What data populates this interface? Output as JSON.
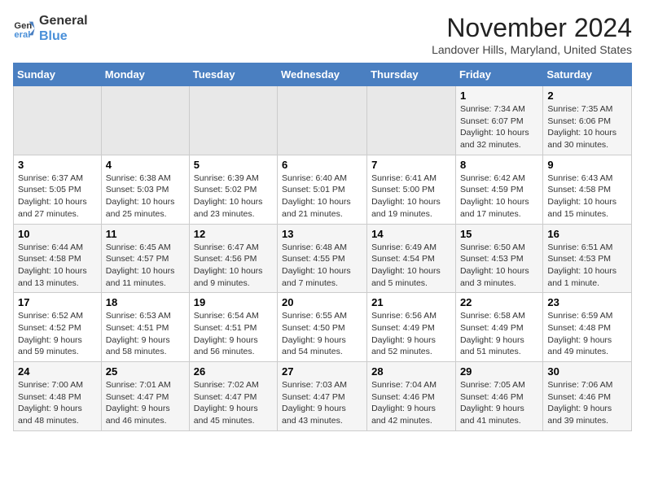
{
  "logo": {
    "line1": "General",
    "line2": "Blue"
  },
  "title": "November 2024",
  "subtitle": "Landover Hills, Maryland, United States",
  "days_of_week": [
    "Sunday",
    "Monday",
    "Tuesday",
    "Wednesday",
    "Thursday",
    "Friday",
    "Saturday"
  ],
  "weeks": [
    [
      {
        "day": "",
        "info": ""
      },
      {
        "day": "",
        "info": ""
      },
      {
        "day": "",
        "info": ""
      },
      {
        "day": "",
        "info": ""
      },
      {
        "day": "",
        "info": ""
      },
      {
        "day": "1",
        "info": "Sunrise: 7:34 AM\nSunset: 6:07 PM\nDaylight: 10 hours and 32 minutes."
      },
      {
        "day": "2",
        "info": "Sunrise: 7:35 AM\nSunset: 6:06 PM\nDaylight: 10 hours and 30 minutes."
      }
    ],
    [
      {
        "day": "3",
        "info": "Sunrise: 6:37 AM\nSunset: 5:05 PM\nDaylight: 10 hours and 27 minutes."
      },
      {
        "day": "4",
        "info": "Sunrise: 6:38 AM\nSunset: 5:03 PM\nDaylight: 10 hours and 25 minutes."
      },
      {
        "day": "5",
        "info": "Sunrise: 6:39 AM\nSunset: 5:02 PM\nDaylight: 10 hours and 23 minutes."
      },
      {
        "day": "6",
        "info": "Sunrise: 6:40 AM\nSunset: 5:01 PM\nDaylight: 10 hours and 21 minutes."
      },
      {
        "day": "7",
        "info": "Sunrise: 6:41 AM\nSunset: 5:00 PM\nDaylight: 10 hours and 19 minutes."
      },
      {
        "day": "8",
        "info": "Sunrise: 6:42 AM\nSunset: 4:59 PM\nDaylight: 10 hours and 17 minutes."
      },
      {
        "day": "9",
        "info": "Sunrise: 6:43 AM\nSunset: 4:58 PM\nDaylight: 10 hours and 15 minutes."
      }
    ],
    [
      {
        "day": "10",
        "info": "Sunrise: 6:44 AM\nSunset: 4:58 PM\nDaylight: 10 hours and 13 minutes."
      },
      {
        "day": "11",
        "info": "Sunrise: 6:45 AM\nSunset: 4:57 PM\nDaylight: 10 hours and 11 minutes."
      },
      {
        "day": "12",
        "info": "Sunrise: 6:47 AM\nSunset: 4:56 PM\nDaylight: 10 hours and 9 minutes."
      },
      {
        "day": "13",
        "info": "Sunrise: 6:48 AM\nSunset: 4:55 PM\nDaylight: 10 hours and 7 minutes."
      },
      {
        "day": "14",
        "info": "Sunrise: 6:49 AM\nSunset: 4:54 PM\nDaylight: 10 hours and 5 minutes."
      },
      {
        "day": "15",
        "info": "Sunrise: 6:50 AM\nSunset: 4:53 PM\nDaylight: 10 hours and 3 minutes."
      },
      {
        "day": "16",
        "info": "Sunrise: 6:51 AM\nSunset: 4:53 PM\nDaylight: 10 hours and 1 minute."
      }
    ],
    [
      {
        "day": "17",
        "info": "Sunrise: 6:52 AM\nSunset: 4:52 PM\nDaylight: 9 hours and 59 minutes."
      },
      {
        "day": "18",
        "info": "Sunrise: 6:53 AM\nSunset: 4:51 PM\nDaylight: 9 hours and 58 minutes."
      },
      {
        "day": "19",
        "info": "Sunrise: 6:54 AM\nSunset: 4:51 PM\nDaylight: 9 hours and 56 minutes."
      },
      {
        "day": "20",
        "info": "Sunrise: 6:55 AM\nSunset: 4:50 PM\nDaylight: 9 hours and 54 minutes."
      },
      {
        "day": "21",
        "info": "Sunrise: 6:56 AM\nSunset: 4:49 PM\nDaylight: 9 hours and 52 minutes."
      },
      {
        "day": "22",
        "info": "Sunrise: 6:58 AM\nSunset: 4:49 PM\nDaylight: 9 hours and 51 minutes."
      },
      {
        "day": "23",
        "info": "Sunrise: 6:59 AM\nSunset: 4:48 PM\nDaylight: 9 hours and 49 minutes."
      }
    ],
    [
      {
        "day": "24",
        "info": "Sunrise: 7:00 AM\nSunset: 4:48 PM\nDaylight: 9 hours and 48 minutes."
      },
      {
        "day": "25",
        "info": "Sunrise: 7:01 AM\nSunset: 4:47 PM\nDaylight: 9 hours and 46 minutes."
      },
      {
        "day": "26",
        "info": "Sunrise: 7:02 AM\nSunset: 4:47 PM\nDaylight: 9 hours and 45 minutes."
      },
      {
        "day": "27",
        "info": "Sunrise: 7:03 AM\nSunset: 4:47 PM\nDaylight: 9 hours and 43 minutes."
      },
      {
        "day": "28",
        "info": "Sunrise: 7:04 AM\nSunset: 4:46 PM\nDaylight: 9 hours and 42 minutes."
      },
      {
        "day": "29",
        "info": "Sunrise: 7:05 AM\nSunset: 4:46 PM\nDaylight: 9 hours and 41 minutes."
      },
      {
        "day": "30",
        "info": "Sunrise: 7:06 AM\nSunset: 4:46 PM\nDaylight: 9 hours and 39 minutes."
      }
    ]
  ]
}
